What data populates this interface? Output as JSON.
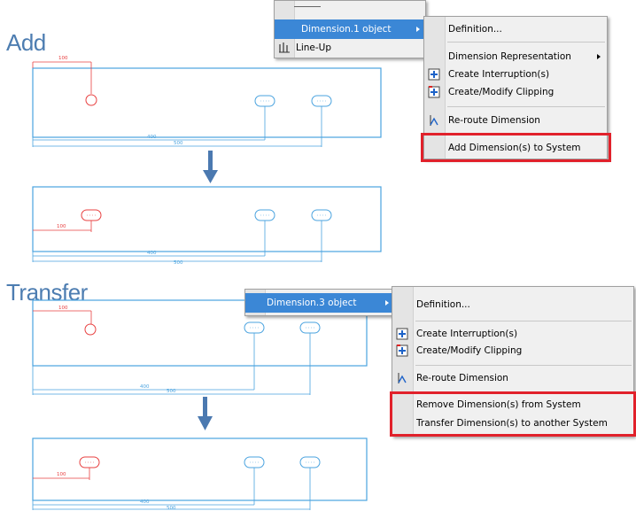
{
  "headings": {
    "add": "Add",
    "transfer": "Transfer"
  },
  "dims": {
    "p1_top": "100",
    "p1_mid": "400",
    "p1_bot": "500",
    "p2_left": "100",
    "p2_mid": "400",
    "p2_bot": "500",
    "p3_top": "100",
    "p3_mid": "400",
    "p3_bot": "500",
    "p4_left": "100",
    "p4_mid": "400",
    "p4_bot": "500"
  },
  "menu_add": {
    "parent": {
      "item1": "Dimension.1 object",
      "item2": "Line-Up"
    },
    "items": {
      "definition": "Definition...",
      "dim_rep": "Dimension Representation",
      "create_interruptions": "Create Interruption(s)",
      "create_clipping": "Create/Modify Clipping",
      "reroute": "Re-route Dimension",
      "add_to_system": "Add Dimension(s) to System"
    }
  },
  "menu_transfer": {
    "parent": {
      "item1": "Dimension.3 object"
    },
    "items": {
      "definition": "Definition...",
      "create_interruptions": "Create Interruption(s)",
      "create_clipping": "Create/Modify Clipping",
      "reroute": "Re-route Dimension",
      "remove_from_system": "Remove Dimension(s) from System",
      "transfer_to_system": "Transfer Dimension(s) to another System"
    }
  },
  "colors": {
    "accent": "#3b87d6",
    "highlight": "#e1212b",
    "heading": "#4d7db1",
    "drawing": "#4aa3df",
    "red": "#e84040"
  }
}
